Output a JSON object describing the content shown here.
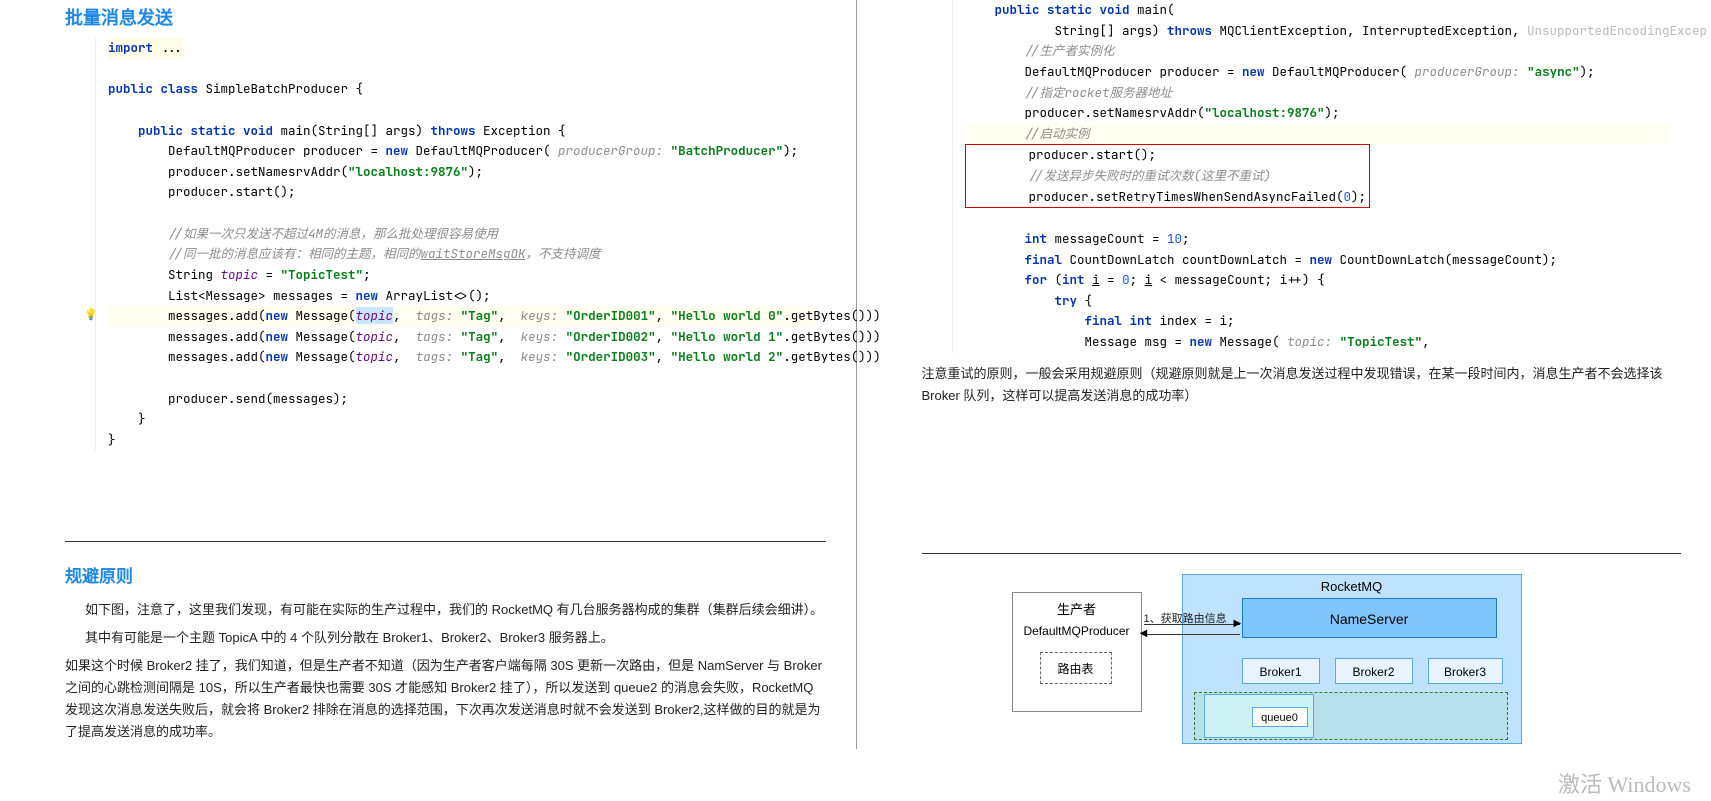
{
  "left": {
    "title": "批量消息发送",
    "code": {
      "l1a": "import",
      "l1b": " ...",
      "l3a": "public class",
      "l3b": " SimpleBatchProducer {",
      "l5a": "    public static void",
      "l5b": " main(String[] args) ",
      "l5c": "throws",
      "l5d": " Exception {",
      "l6a": "        DefaultMQProducer producer = ",
      "l6b": "new",
      "l6c": " DefaultMQProducer( ",
      "l6d": "producerGroup:",
      "l6e": " \"BatchProducer\"",
      "l6f": ");",
      "l7a": "        producer.setNamesrvAddr(",
      "l7b": "\"localhost:9876\"",
      "l7c": ");",
      "l8": "        producer.start();",
      "c1": "        //如果一次只发送不超过4M的消息，那么批处理很容易使用",
      "c2a": "        //同一批的消息应该有：相同的主题，相同的",
      "c2b": "waitStoreMsgOK",
      "c2c": "，不支持调度",
      "l11a": "        String ",
      "l11b": "topic",
      "l11c": " = ",
      "l11d": "\"TopicTest\"",
      "l11e": ";",
      "l12a": "        List<Message> messages = ",
      "l12b": "new",
      "l12c": " ArrayList<>();",
      "l13a": "        messages.add(",
      "l13b": "new",
      "l13c": " Message(",
      "l13t": "topic",
      "l13d": ",  ",
      "l13e": "tags:",
      "l13f": " \"Tag\"",
      "l13g": ",  ",
      "l13h": "keys:",
      "l13i": " \"OrderID001\"",
      "l13j": ", ",
      "l13k": "\"Hello world 0\"",
      "l13l": ".getBytes()))",
      "l14i": " \"OrderID002\"",
      "l14k": "\"Hello world 1\"",
      "l15i": " \"OrderID003\"",
      "l15k": "\"Hello world 2\"",
      "l17": "        producer.send(messages);",
      "l18": "    }",
      "l19": "}"
    },
    "avoid_title": "规避原则",
    "para1": "如下图，注意了，这里我们发现，有可能在实际的生产过程中，我们的 RocketMQ 有几台服务器构成的集群（集群后续会细讲）。",
    "para2": "其中有可能是一个主题 TopicA 中的 4 个队列分散在 Broker1、Broker2、Broker3 服务器上。",
    "para3": "如果这个时候 Broker2 挂了，我们知道，但是生产者不知道（因为生产者客户端每隔 30S 更新一次路由，但是 NamServer 与 Broker 之间的心跳检测间隔是 10S，所以生产者最快也需要 30S 才能感知 Broker2 挂了），所以发送到 queue2 的消息会失败，RocketMQ 发现这次消息发送失败后，就会将 Broker2 排除在消息的选择范围，下次再次发送消息时就不会发送到 Broker2,这样做的目的就是为了提高发送消息的成功率。"
  },
  "right": {
    "code": {
      "l1a": "    public static void",
      "l1b": " main(",
      "l2a": "            String[] args) ",
      "l2b": "throws",
      "l2c": " MQClientException, InterruptedException, ",
      "l2d": "UnsupportedEncodingExcep",
      "c1": "        //生产者实例化",
      "l4a": "        DefaultMQProducer producer = ",
      "l4b": "new",
      "l4c": " DefaultMQProducer( ",
      "l4d": "producerGroup:",
      "l4e": " \"async\"",
      "l4f": ");",
      "c2": "        //指定rocket服务器地址",
      "l6a": "        producer.setNamesrvAddr(",
      "l6b": "\"localhost:9876\"",
      "l6c": ");",
      "c3": "        //启动实例",
      "l8": "        producer.start();",
      "c4": "        //发送异步失败时的重试次数(这里不重试)",
      "l10a": "        producer.setRetryTimesWhenSendAsyncFailed(",
      "l10b": "0",
      "l10c": ");",
      "l12a": "        int",
      "l12b": " messageCount = ",
      "l12c": "10",
      "l12d": ";",
      "l13a": "        final",
      "l13b": " CountDownLatch countDownLatch = ",
      "l13c": "new",
      "l13d": " CountDownLatch(messageCount);",
      "l14a": "        for",
      "l14b": " (",
      "l14c": "int",
      "l14d": " ",
      "l14e": "i",
      "l14f": " = ",
      "l14g": "0",
      "l14h": "; ",
      "l14i": "i",
      "l14j": " < messageCount; i++) {",
      "l15a": "            try",
      "l15b": " {",
      "l16a": "                final int",
      "l16b": " index = i;",
      "l17a": "                Message msg = ",
      "l17b": "new",
      "l17c": " Message( ",
      "l17d": "topic:",
      "l17e": " \"TopicTest\"",
      "l17f": ","
    },
    "retry_para": "注意重试的原则，一般会采用规避原则（规避原则就是上一次消息发送过程中发现错误，在某一段时间内，消息生产者不会选择该 Broker 队列，这样可以提高发送消息的成功率）",
    "diagram": {
      "rocketmq": "RocketMQ",
      "nameserver": "NameServer",
      "broker1": "Broker1",
      "broker2": "Broker2",
      "broker3": "Broker3",
      "producer_title": "生产者",
      "producer_sub": "DefaultMQProducer",
      "route_table": "路由表",
      "arrow1": "1、获取路由信息",
      "queue0": "queue0"
    },
    "watermark": "激活 Windows"
  }
}
